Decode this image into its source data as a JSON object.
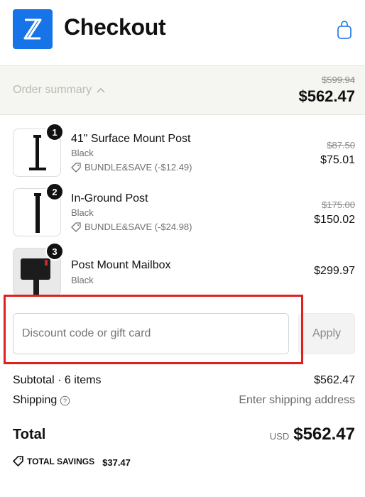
{
  "header": {
    "title": "Checkout",
    "logo_icon": "x-diamond-logo-icon",
    "cart_icon": "shopping-bag-icon",
    "brand_color": "#1773e8"
  },
  "summary": {
    "toggle_label": "Order summary",
    "toggle_icon": "chevron-up-icon",
    "original_total": "$599.94",
    "total": "$562.47"
  },
  "items": [
    {
      "quantity": "1",
      "name": "41\" Surface Mount Post",
      "variant": "Black",
      "discount": "BUNDLE&SAVE (-$12.49)",
      "original_price": "$87.50",
      "price": "$75.01"
    },
    {
      "quantity": "2",
      "name": "In-Ground Post",
      "variant": "Black",
      "discount": "BUNDLE&SAVE (-$24.98)",
      "original_price": "$175.00",
      "price": "$150.02"
    },
    {
      "quantity": "3",
      "name": "Post Mount Mailbox",
      "variant": "Black",
      "price": "$299.97"
    }
  ],
  "discount": {
    "placeholder": "Discount code or gift card",
    "apply_label": "Apply"
  },
  "totals": {
    "subtotal_label": "Subtotal · 6 items",
    "subtotal_value": "$562.47",
    "shipping_label": "Shipping",
    "shipping_value": "Enter shipping address",
    "total_label": "Total",
    "currency": "USD",
    "total_value": "$562.47",
    "savings_label": "TOTAL SAVINGS",
    "savings_value": "$37.47"
  },
  "colors": {
    "highlight": "#e0201f",
    "summary_bg": "#f5f6f2"
  }
}
